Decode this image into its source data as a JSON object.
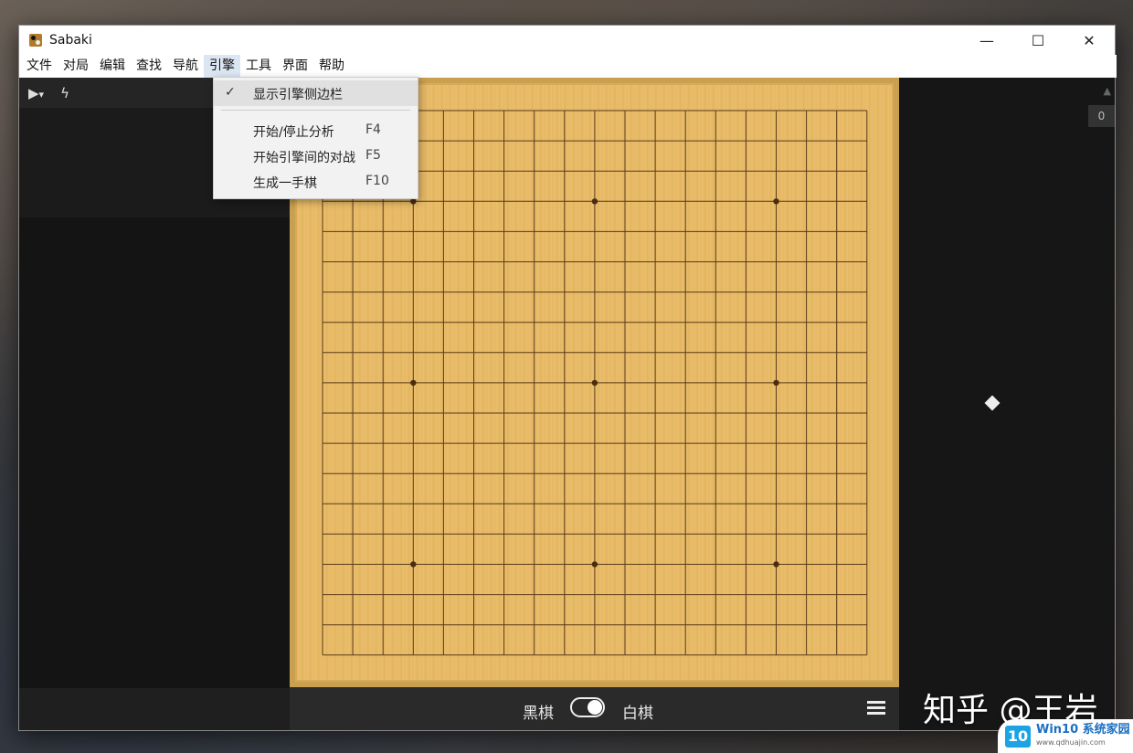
{
  "window": {
    "title": "Sabaki"
  },
  "window_controls": {
    "minimize": "—",
    "maximize": "☐",
    "close": "✕"
  },
  "menubar": {
    "items": [
      "文件",
      "对局",
      "编辑",
      "查找",
      "导航",
      "引擎",
      "工具",
      "界面",
      "帮助"
    ],
    "active": "引擎"
  },
  "left_toolbar": {
    "play_icon": "▶",
    "dropdown_caret": "▾",
    "bolt_icon": "ϟ"
  },
  "engine_menu": {
    "items": [
      {
        "label": "显示引擎侧边栏",
        "checked": true,
        "shortcut": ""
      },
      {
        "label": "开始/停止分析",
        "checked": false,
        "shortcut": "F4"
      },
      {
        "label": "开始引擎间的对战",
        "checked": false,
        "shortcut": "F5"
      },
      {
        "label": "生成一手棋",
        "checked": false,
        "shortcut": "F10"
      }
    ],
    "check_mark": "✓"
  },
  "board": {
    "size": 19,
    "star_points": [
      [
        3,
        3
      ],
      [
        3,
        9
      ],
      [
        3,
        15
      ],
      [
        9,
        3
      ],
      [
        9,
        9
      ],
      [
        9,
        15
      ],
      [
        15,
        3
      ],
      [
        15,
        9
      ],
      [
        15,
        15
      ]
    ]
  },
  "player_bar": {
    "black_label": "黑棋",
    "white_label": "白棋",
    "toggle_on": true
  },
  "right_panel": {
    "move_count": "0"
  },
  "watermark": {
    "text": "知乎 @王岩"
  },
  "site_badge": {
    "logo": "10",
    "name": "Win10 系统家园",
    "url": "www.qdhuajin.com"
  }
}
